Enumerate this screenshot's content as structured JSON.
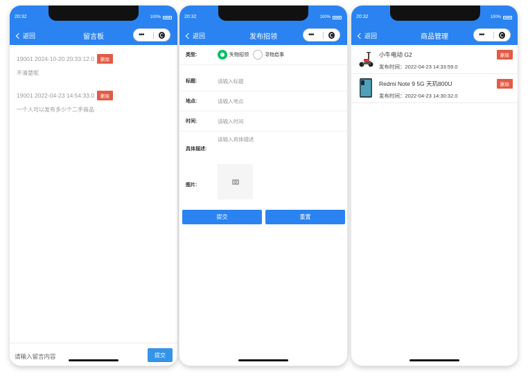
{
  "status": {
    "time_p1": "20:32",
    "time_p2": "20:32",
    "time_p3": "20:32",
    "battery": "100%"
  },
  "nav": {
    "back_label": "返回"
  },
  "board": {
    "title": "留言板",
    "messages": [
      {
        "header": "19001 2024-10-20 20:33:12.0",
        "delete": "删除",
        "text": "不清楚呢"
      },
      {
        "header": "19001 2022-04-23 14:54:33.0",
        "delete": "删除",
        "text": "一个人可以发布多少个二手商品"
      }
    ],
    "input_placeholder": "请输入留言内容",
    "submit_label": "提交"
  },
  "publish": {
    "title": "发布招领",
    "type_label": "类型:",
    "type_options": [
      "失物招领",
      "寻物启事"
    ],
    "selected_type": "失物招领",
    "fields": [
      {
        "label": "标题:",
        "placeholder": "请输入标题"
      },
      {
        "label": "地点:",
        "placeholder": "请输入地点"
      },
      {
        "label": "时间:",
        "placeholder": "请输入时间"
      },
      {
        "label": "具体描述:",
        "placeholder": "请输入具体描述"
      }
    ],
    "image_label": "图片:",
    "submit_label": "提交",
    "reset_label": "重置"
  },
  "goods": {
    "title": "商品管理",
    "items": [
      {
        "name": "小牛电动 G2",
        "time": "发布时间：2022-04-23 14:33:59.0",
        "delete": "删除"
      },
      {
        "name": "Redmi Note 9 5G 天玑800U",
        "time": "发布时间：2022-04-23 14:30:32.0",
        "delete": "删除"
      }
    ]
  }
}
